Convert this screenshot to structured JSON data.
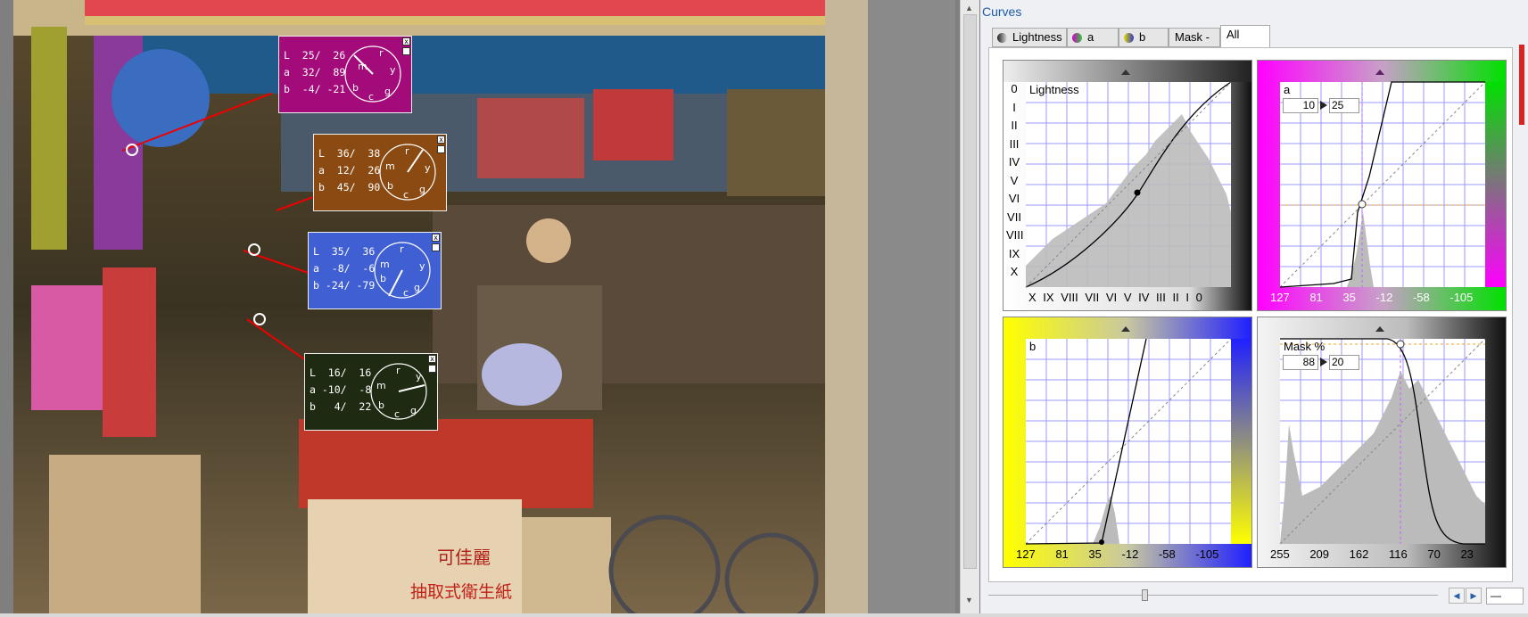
{
  "panel": {
    "title": "Curves",
    "tabs": [
      {
        "label": "Lightness",
        "icon": "lightness-tab-icon"
      },
      {
        "label": "a",
        "icon": "a-channel-tab-icon"
      },
      {
        "label": "b",
        "icon": "b-channel-tab-icon"
      },
      {
        "label": "Mask - K",
        "icon": ""
      },
      {
        "label": "All",
        "icon": ""
      }
    ],
    "active_tab": "All"
  },
  "curves": {
    "lightness": {
      "label": "Lightness",
      "y_labels": [
        "0",
        "I",
        "II",
        "III",
        "IV",
        "V",
        "VI",
        "VII",
        "VIII",
        "IX",
        "X"
      ],
      "x_labels": [
        "X",
        "IX",
        "VIII",
        "VII",
        "VI",
        "V",
        "IV",
        "III",
        "II",
        "I",
        "0"
      ]
    },
    "a": {
      "label": "a",
      "input": "10",
      "output": "25",
      "x_labels": [
        "127",
        "81",
        "35",
        "-12",
        "-58",
        "-105"
      ]
    },
    "b": {
      "label": "b",
      "x_labels": [
        "127",
        "81",
        "35",
        "-12",
        "-58",
        "-105"
      ]
    },
    "mask": {
      "label": "Mask %",
      "input": "88",
      "output": "20",
      "x_labels": [
        "255",
        "209",
        "162",
        "116",
        "70",
        "23"
      ]
    }
  },
  "readouts": [
    {
      "L": "25/  26",
      "a": "32/  89",
      "b": "-4/ -21",
      "color": "#a30b7a"
    },
    {
      "L": "36/  38",
      "a": "12/  26",
      "b": "45/  90",
      "color": "#8a4a12"
    },
    {
      "L": "35/  36",
      "a": "-8/  -6",
      "b": "-24/ -79",
      "color": "#3f5fd3"
    },
    {
      "L": "16/  16",
      "a": "-10/  -8",
      "b": "4/  22",
      "color": "#1f2a12"
    }
  ],
  "dial_labels": {
    "m": "m",
    "r": "r",
    "y": "y",
    "g": "g",
    "c": "c",
    "b": "b"
  },
  "zoom_field": "—",
  "colors": {
    "accent": "#1c5aa8",
    "magenta": "#ff00ff",
    "yellow": "#ffff00",
    "grid": "#8080ff"
  }
}
